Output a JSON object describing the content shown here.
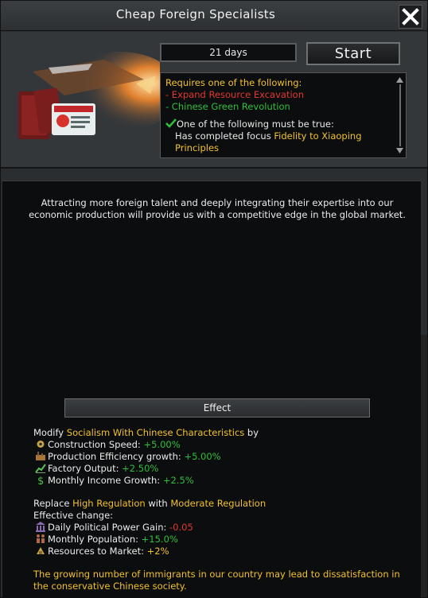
{
  "window": {
    "title": "Cheap Foreign Specialists"
  },
  "header": {
    "duration": "21 days",
    "start_label": "Start",
    "requirements": {
      "heading": "Requires one of the following:",
      "items": [
        "- Expand Resource Excavation",
        "- Chinese Green Revolution"
      ],
      "condition_heading": "One of the following must be true:",
      "condition_prefix": "Has completed focus",
      "condition_focus": "Fidelity to Xiaoping Principles"
    }
  },
  "main": {
    "description": "Attracting more foreign talent and deeply integrating their expertise into our economic production will provide us with a competitive edge in the global market.",
    "effect_title": "Effect",
    "modify": {
      "prefix": "Modify",
      "target": "Socialism With Chinese Characteristics",
      "suffix": "by",
      "stats": [
        {
          "icon": "gear-icon",
          "label": "Construction Speed:",
          "value": "+5.00%"
        },
        {
          "icon": "factory-icon",
          "label": "Production Efficiency growth:",
          "value": "+5.00%"
        },
        {
          "icon": "chart-icon",
          "label": "Factory Output:",
          "value": "+2.50%"
        },
        {
          "icon": "money-icon",
          "label": "Monthly Income Growth:",
          "value": "+2.5%"
        }
      ]
    },
    "replace": {
      "prefix": "Replace",
      "from": "High Regulation",
      "middle": "with",
      "to": "Moderate Regulation",
      "effective": "Effective change:",
      "stats": [
        {
          "icon": "building-icon",
          "label": "Daily Political Power Gain:",
          "value": "-0.05",
          "color": "#e3372f"
        },
        {
          "icon": "people-icon",
          "label": "Monthly Population:",
          "value": "+15.0%",
          "color": "#2fbf3c"
        },
        {
          "icon": "resources-icon",
          "label": "Resources to Market:",
          "value": "+2%",
          "color": "#f2c12e"
        }
      ]
    },
    "warning": "The growing number of immigrants in our country may lead to dissatisfaction in the conservative Chinese society."
  },
  "colors": {
    "yellow": "#f2c12e",
    "red": "#e3372f",
    "green": "#2fbf3c",
    "panel": "#0c0d0e"
  }
}
